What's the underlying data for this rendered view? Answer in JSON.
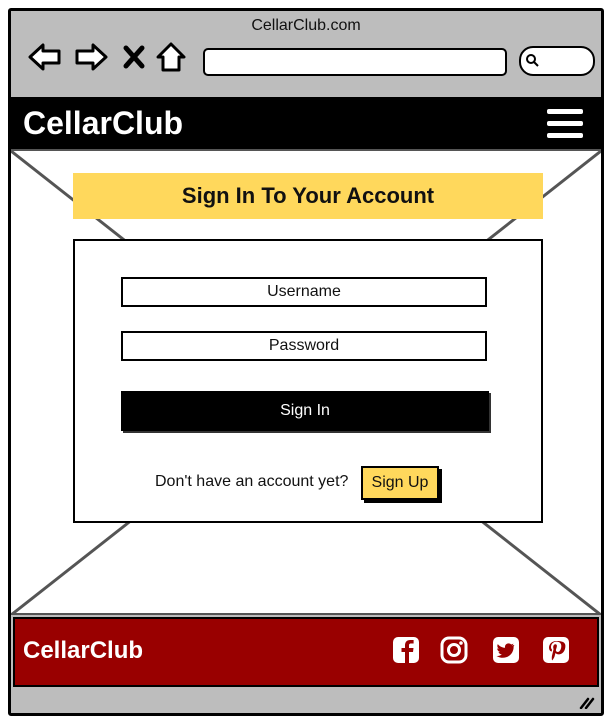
{
  "browser": {
    "title": "CellarClub.com",
    "url_value": "",
    "search_value": "",
    "icons": [
      "back-arrow-icon",
      "forward-arrow-icon",
      "stop-icon",
      "home-icon",
      "search-icon"
    ]
  },
  "header": {
    "brand": "CellarClub",
    "menu_icon": "hamburger-menu-icon"
  },
  "signin": {
    "heading": "Sign In To Your Account",
    "username_placeholder": "Username",
    "password_placeholder": "Password",
    "submit_label": "Sign In",
    "no_account_text": "Don't have an account yet?",
    "signup_label": "Sign Up"
  },
  "footer": {
    "brand": "CellarClub",
    "social": [
      {
        "icon": "facebook-icon"
      },
      {
        "icon": "instagram-icon"
      },
      {
        "icon": "twitter-icon"
      },
      {
        "icon": "pinterest-icon"
      }
    ]
  },
  "colors": {
    "accent_yellow": "#ffd85c",
    "footer_red": "#990000",
    "header_black": "#000000",
    "chrome_gray": "#bdbdbd"
  }
}
